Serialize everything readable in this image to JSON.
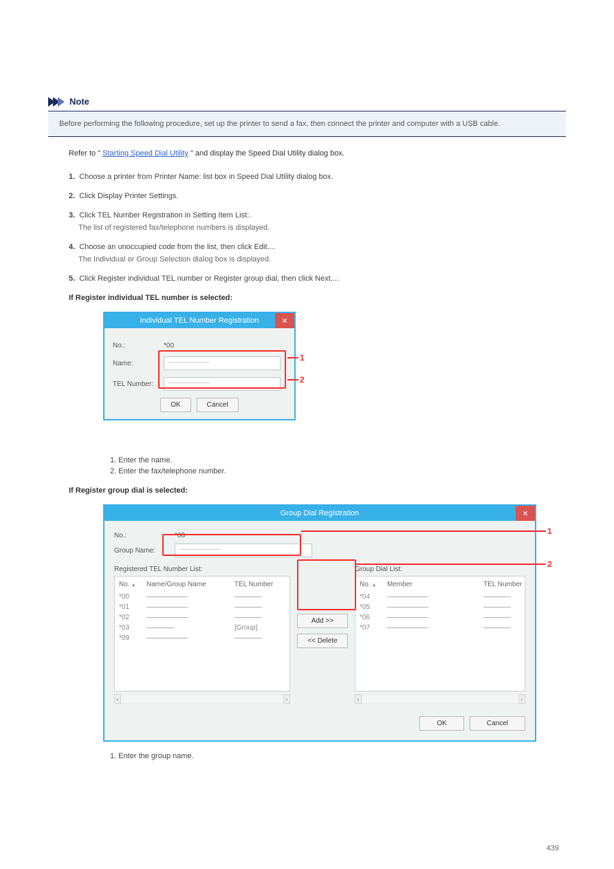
{
  "section": {
    "note_heading": "Note",
    "note_body": "Before performing the following procedure, set up the printer to send a fax, then connect the printer and computer with a USB cable.",
    "link_prefix": "Refer to \"",
    "link_text": "Starting Speed Dial Utility",
    "link_suffix": "\" and display the Speed Dial Utility dialog box."
  },
  "steps": [
    {
      "n": "1.",
      "text": "Choose a printer from Printer Name: list box in Speed Dial Utility dialog box."
    },
    {
      "n": "2.",
      "text": "Click Display Printer Settings."
    },
    {
      "n": "3.",
      "text": "Click TEL Number Registration in Setting Item List:.",
      "desc": "The list of registered fax/telephone numbers is displayed."
    },
    {
      "n": "4.",
      "text": "Choose an unoccupied code from the list, then click Edit....",
      "desc": "The Individual or Group Selection dialog box is displayed."
    },
    {
      "n": "5.",
      "text": "Click Register individual TEL number or Register group dial, then click Next....",
      "descA": "If Register individual TEL number is selected:",
      "descB": "If Register group dial is selected:"
    }
  ],
  "dlg1": {
    "title": "Individual TEL Number Registration",
    "no_label": "No.:",
    "no_value": "*00",
    "name_label": "Name:",
    "name_value": "——————",
    "tel_label": "TEL Number:",
    "tel_value": "——————",
    "ok": "OK",
    "cancel": "Cancel",
    "post1": "1. Enter the name.",
    "post2": "2. Enter the fax/telephone number."
  },
  "dlg2": {
    "title": "Group Dial Registration",
    "no_label": "No.:",
    "no_value": "*08",
    "gname_label": "Group Name:",
    "gname_value": "——————",
    "reglist_label": "Registered TEL Number List:",
    "grouplist_label": "Group Dial List:",
    "hdr_no": "No.",
    "hdr_name": "Name/Group Name",
    "hdr_tel": "TEL Number",
    "hdr_member": "Member",
    "add": "Add >>",
    "del": "<< Delete",
    "ok": "OK",
    "cancel": "Cancel",
    "left_rows": [
      {
        "no": "*00",
        "name": "——————",
        "tel": "————"
      },
      {
        "no": "*01",
        "name": "——————",
        "tel": "————"
      },
      {
        "no": "*02",
        "name": "——————",
        "tel": "————"
      },
      {
        "no": "*03",
        "name": "————",
        "tel": "[Group]"
      },
      {
        "no": "*09",
        "name": "——————",
        "tel": "————"
      }
    ],
    "right_rows": [
      {
        "no": "*04",
        "mem": "——————",
        "tel": "————"
      },
      {
        "no": "*05",
        "mem": "——————",
        "tel": "————"
      },
      {
        "no": "*06",
        "mem": "——————",
        "tel": "————"
      },
      {
        "no": "*07",
        "mem": "——————",
        "tel": "————"
      }
    ],
    "post1": "1. Enter the group name."
  },
  "footer": {
    "page": "439"
  }
}
